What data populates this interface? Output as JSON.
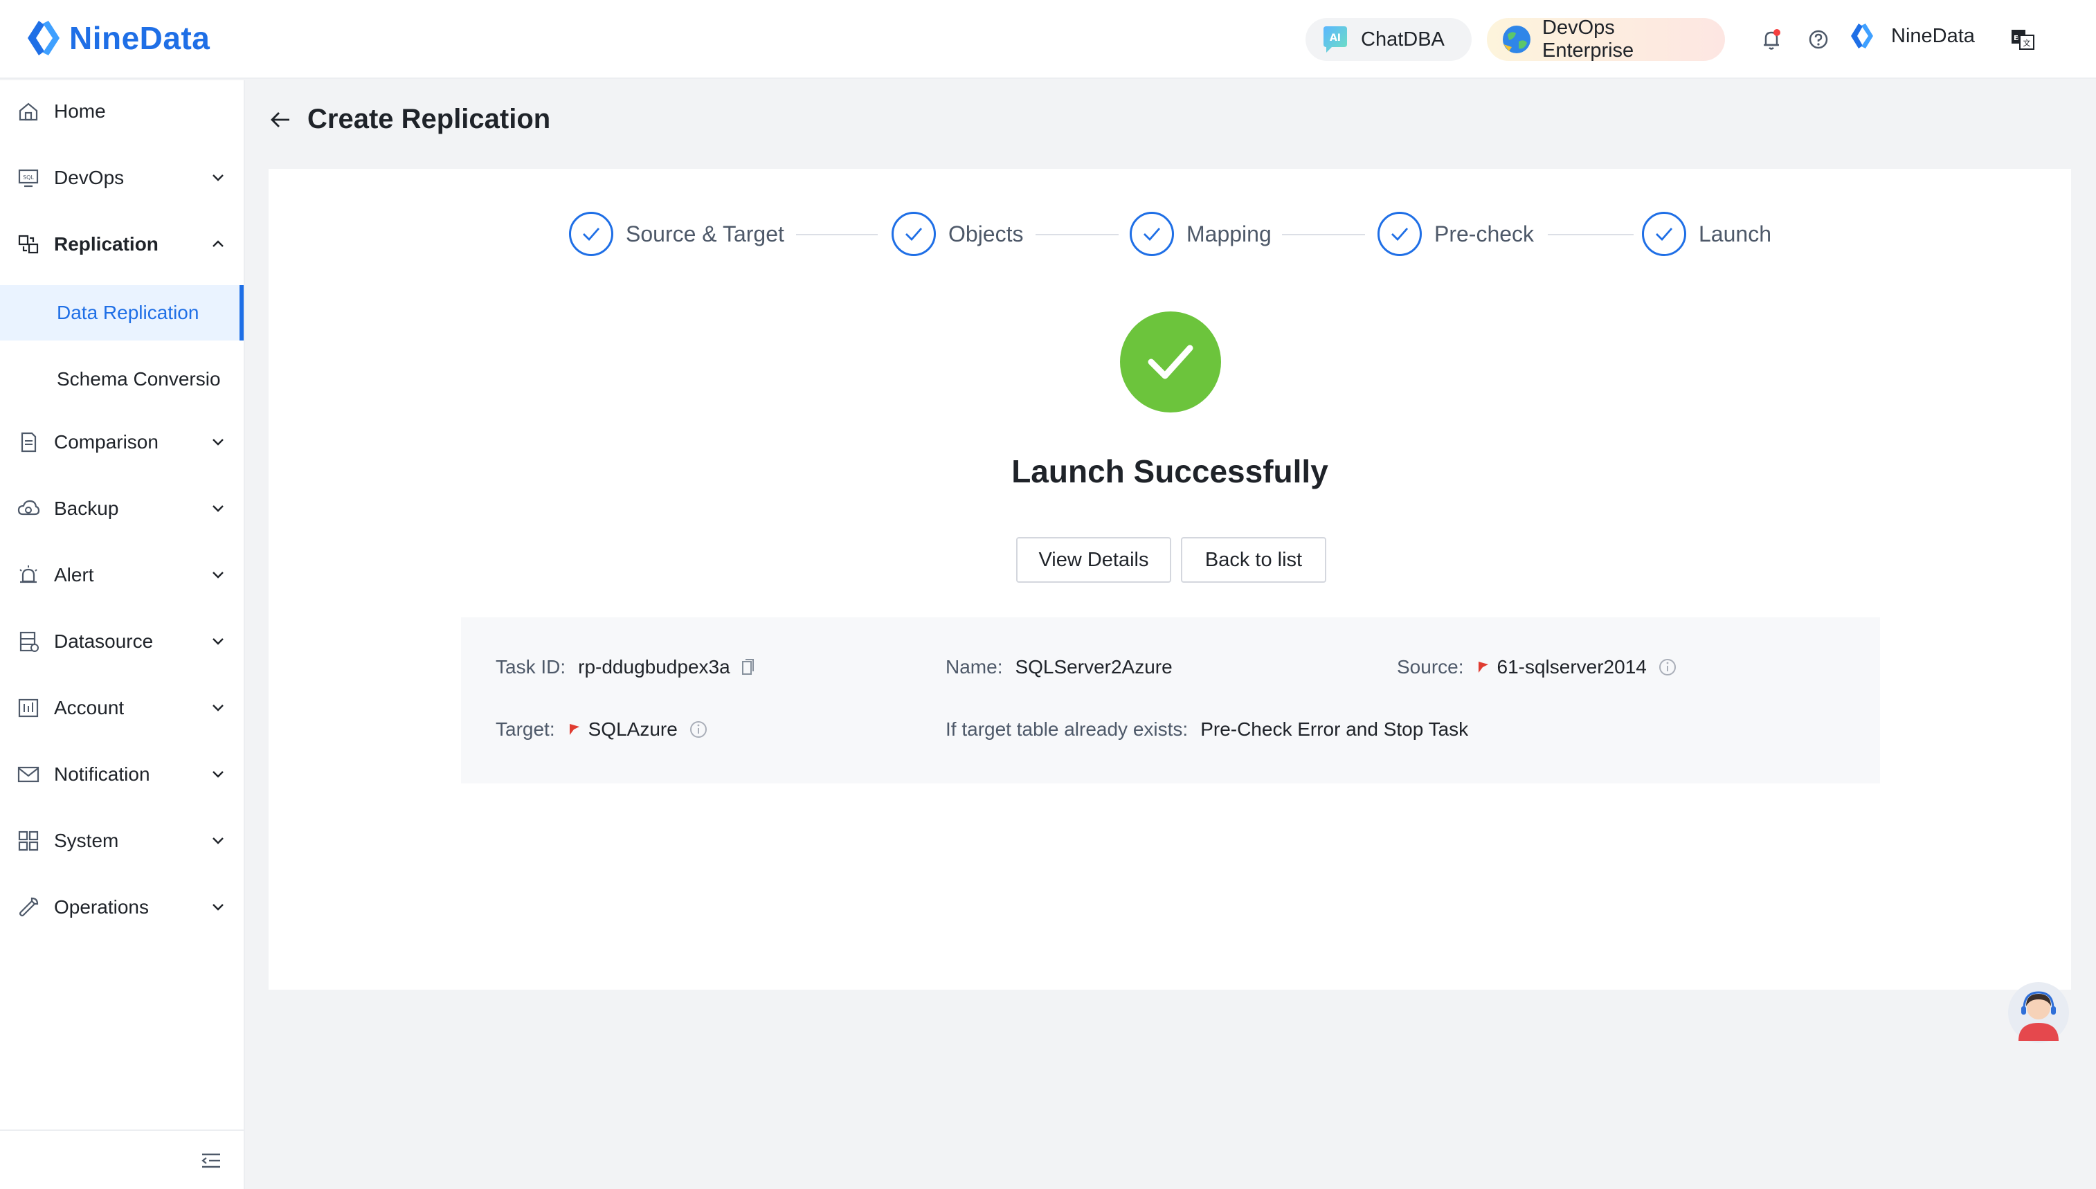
{
  "brand": {
    "name": "NineData",
    "color": "#1f6fe6"
  },
  "header": {
    "chatdba_label": "ChatDBA",
    "devops_label": "DevOps Enterprise",
    "user_label": "NineData",
    "icons": [
      "ai-icon",
      "globe-icon",
      "bell-icon",
      "help-icon",
      "ninedata-logo-icon",
      "language-icon"
    ]
  },
  "sidebar": {
    "items": [
      {
        "label": "Home",
        "icon": "home-icon"
      },
      {
        "label": "DevOps",
        "icon": "devops-icon"
      },
      {
        "label": "Replication",
        "icon": "replication-icon"
      },
      {
        "label": "Comparison",
        "icon": "comparison-icon"
      },
      {
        "label": "Backup",
        "icon": "backup-icon"
      },
      {
        "label": "Alert",
        "icon": "alert-icon"
      },
      {
        "label": "Datasource",
        "icon": "datasource-icon"
      },
      {
        "label": "Account",
        "icon": "account-icon"
      },
      {
        "label": "Notification",
        "icon": "notification-icon"
      },
      {
        "label": "System",
        "icon": "system-icon"
      },
      {
        "label": "Operations",
        "icon": "operations-icon"
      }
    ],
    "sub_items": [
      {
        "label": "Data Replication",
        "active": true
      },
      {
        "label": "Schema Conversio",
        "active": false
      }
    ]
  },
  "page": {
    "title": "Create Replication"
  },
  "steps": [
    "Source & Target",
    "Objects",
    "Mapping",
    "Pre-check",
    "Launch"
  ],
  "result": {
    "title": "Launch Successfully",
    "view_details": "View Details",
    "back_to_list": "Back to list",
    "success_color": "#6cc43c"
  },
  "task": {
    "task_id_label": "Task ID:",
    "task_id": "rp-ddugbudpex3a",
    "name_label": "Name:",
    "name": "SQLServer2Azure",
    "source_label": "Source:",
    "source": "61-sqlserver2014",
    "target_label": "Target:",
    "target": "SQLAzure",
    "exists_label": "If target table already exists:",
    "exists_value": "Pre-Check Error and Stop Task"
  }
}
